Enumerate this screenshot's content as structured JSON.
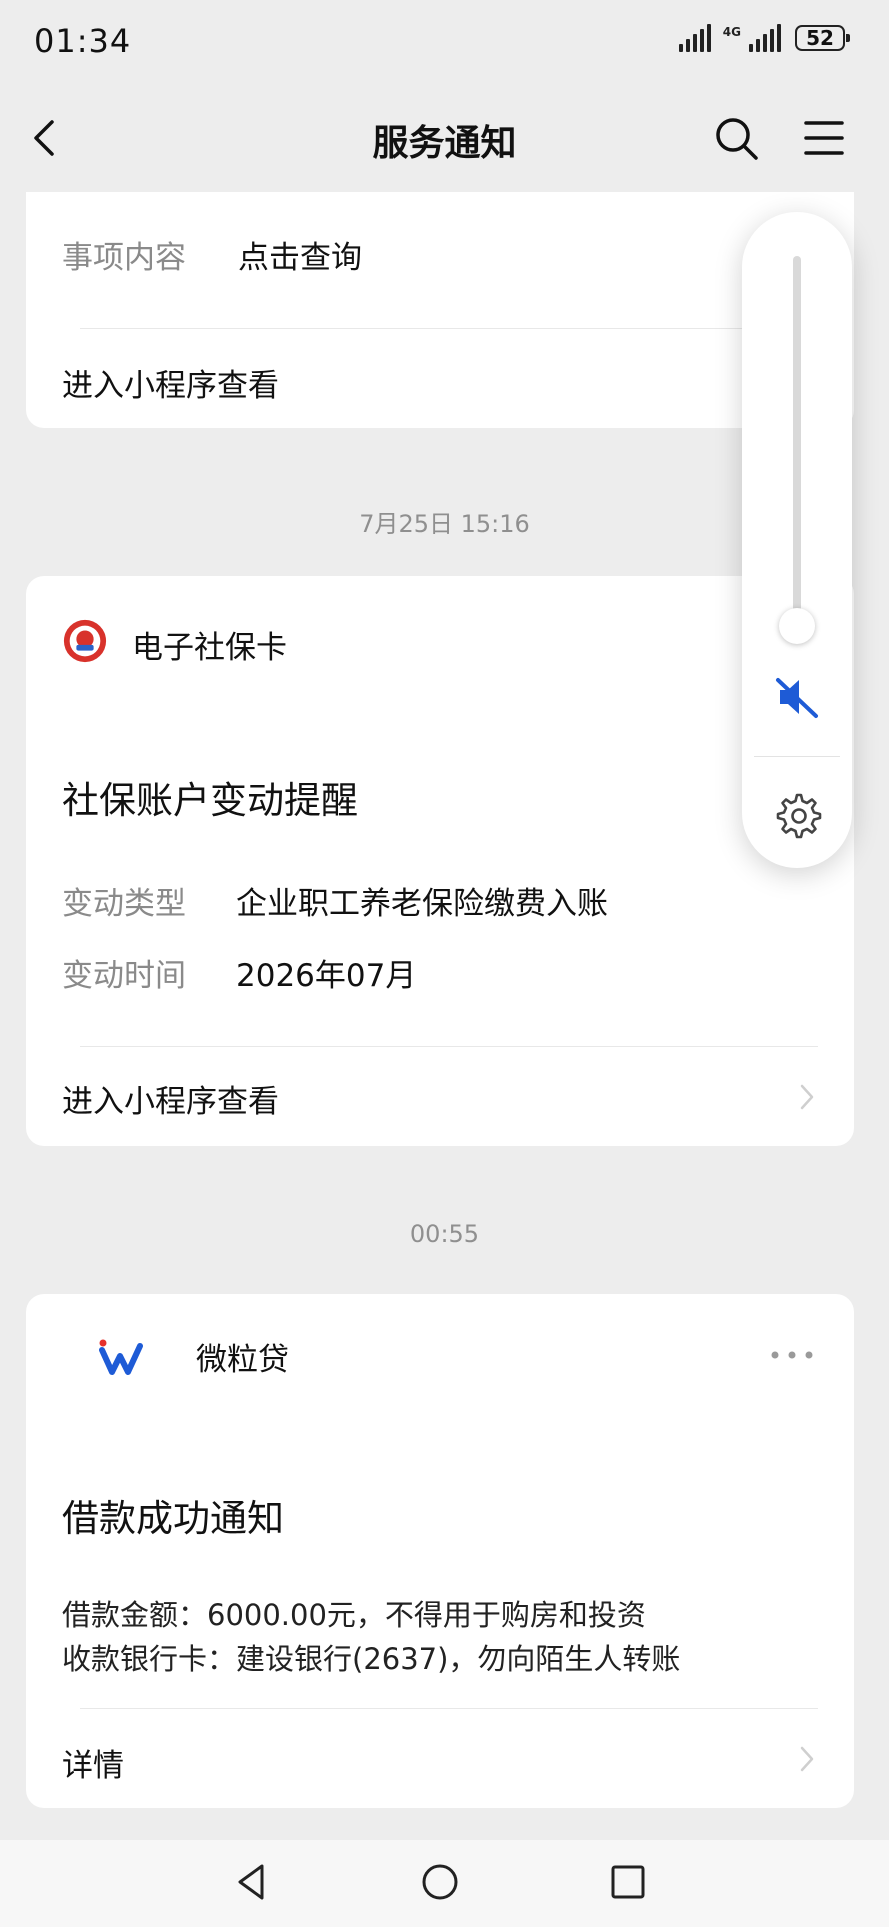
{
  "status_bar": {
    "time": "01:34",
    "network": "4G",
    "battery": "52"
  },
  "nav": {
    "title": "服务通知",
    "icons": [
      "back-icon",
      "search-icon",
      "menu-icon"
    ]
  },
  "card_prev": {
    "rows": [
      {
        "label": "事项内容",
        "value": "点击查询"
      }
    ],
    "link": "进入小程序查看"
  },
  "ts1": "7月25日 15:16",
  "card_social": {
    "app_name": "电子社保卡",
    "title": "社保账户变动提醒",
    "rows": [
      {
        "label": "变动类型",
        "value": "企业职工养老保险缴费入账"
      },
      {
        "label": "变动时间",
        "value": "2026年07月"
      }
    ],
    "link": "进入小程序查看"
  },
  "ts2": "00:55",
  "card_loan": {
    "app_name": "微粒贷",
    "title": "借款成功通知",
    "lines": [
      "借款金额：6000.00元，不得用于购房和投资",
      "收款银行卡：建设银行(2637)，勿向陌生人转账"
    ],
    "link": "详情"
  },
  "volume_panel": {
    "level": 0,
    "muted": true,
    "icons": [
      "mute-icon",
      "gear-icon"
    ]
  },
  "colors": {
    "accent_blue": "#1e5bd6",
    "background": "#ededed",
    "card": "#ffffff"
  }
}
